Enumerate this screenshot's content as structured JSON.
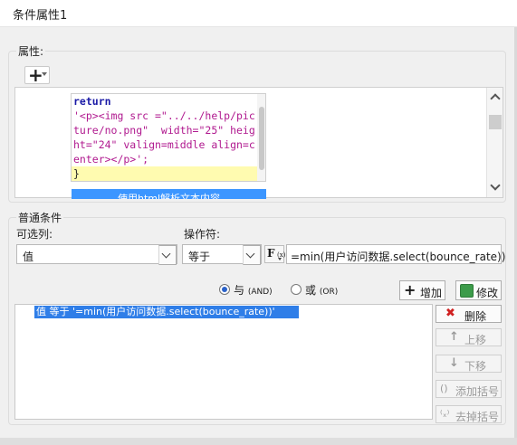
{
  "window": {
    "title": "条件属性1"
  },
  "properties": {
    "group_label": "属性:",
    "add_button_icon": "plus-icon",
    "code_tip": {
      "lines": [
        "return",
        "'<p><img src =\"../../help/pic",
        "ture/no.png\"  width=\"25\" heig",
        "ht=\"24\" valign=middle align=c",
        "enter></p>';",
        "}"
      ]
    },
    "html_option_label": "使用html解析文本内容"
  },
  "general": {
    "group_label": "普通条件",
    "column_label": "可选列:",
    "column_value": "值",
    "operator_label": "操作符:",
    "operator_value": "等于",
    "formula_icon_text": "F",
    "formula_icon_sub": "(x)",
    "expression_value": "=min(用户访问数据.select(bounce_rate))",
    "and_label": "与",
    "and_paren": "(AND)",
    "or_label": "或",
    "or_paren": "(OR)",
    "add_label": "增加",
    "modify_label": "修改",
    "condition_item": "值 等于 '=min(用户访问数据.select(bounce_rate))'",
    "delete_label": "删除",
    "up_label": "上移",
    "down_label": "下移",
    "add_bracket_label": "添加括号",
    "remove_bracket_label": "去掉括号"
  }
}
